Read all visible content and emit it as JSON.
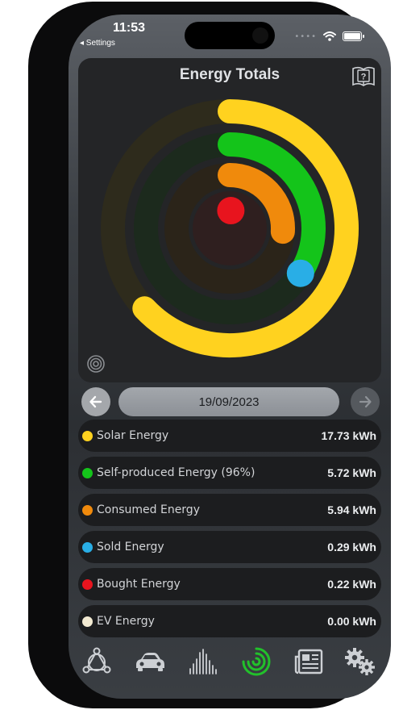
{
  "status_bar": {
    "time": "11:53",
    "back_label": "◂ Settings",
    "signal_dots": "••••"
  },
  "card": {
    "title": "Energy Totals",
    "help_icon": "book-question-icon",
    "settings_icon": "ring-settings-icon"
  },
  "date_nav": {
    "date": "19/09/2023",
    "prev_icon": "arrow-left-icon",
    "next_icon": "arrow-right-icon"
  },
  "energy_rows": [
    {
      "label": "Solar Energy",
      "value": "17.73 kWh",
      "color": "#ffd21f"
    },
    {
      "label": "Self-produced Energy (96%)",
      "value": "5.72 kWh",
      "color": "#14c41a"
    },
    {
      "label": "Consumed Energy",
      "value": "5.94 kWh",
      "color": "#f08a0c"
    },
    {
      "label": "Sold Energy",
      "value": "0.29 kWh",
      "color": "#29aee6"
    },
    {
      "label": "Bought Energy",
      "value": "0.22 kWh",
      "color": "#e8141e"
    },
    {
      "label": "EV Energy",
      "value": "0.00 kWh",
      "color": "#f2ead2"
    }
  ],
  "rings": {
    "solar_fraction": 0.63,
    "self_produced_fraction": 0.34,
    "consumed_fraction": 0.26,
    "bought_fraction": 0.01
  },
  "tabbar": [
    {
      "name": "tab-system",
      "icon": "triangle-network-icon",
      "active": false
    },
    {
      "name": "tab-ev",
      "icon": "car-icon",
      "active": false
    },
    {
      "name": "tab-history",
      "icon": "bar-chart-icon",
      "active": false
    },
    {
      "name": "tab-energy-totals",
      "icon": "rings-icon",
      "active": true
    },
    {
      "name": "tab-reports",
      "icon": "newspaper-icon",
      "active": false
    },
    {
      "name": "tab-settings",
      "icon": "gears-icon",
      "active": false
    }
  ],
  "colors": {
    "accent_active": "#22c12b",
    "card_bg": "#242527"
  }
}
